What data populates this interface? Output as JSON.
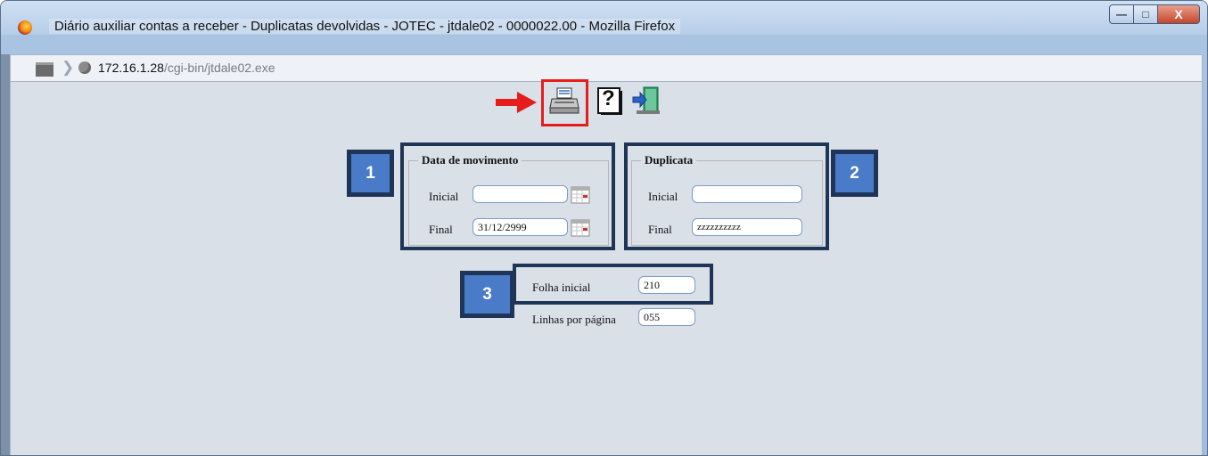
{
  "window": {
    "title": "Diário auxiliar contas a receber - Duplicatas devolvidas - JOTEC - jtdale02 - 0000022.00 - Mozilla Firefox",
    "minimize_label": "—",
    "maximize_label": "□",
    "close_label": "X"
  },
  "address_bar": {
    "host": "172.16.1.28",
    "path": "/cgi-bin/jtdale02.exe"
  },
  "toolbar": {
    "icons": [
      "printer-icon",
      "help-icon",
      "exit-icon"
    ],
    "help_glyph": "?"
  },
  "annotations": {
    "badge_1": "1",
    "badge_2": "2",
    "badge_3": "3",
    "highlight_color": "#e61d1d",
    "frame_color": "#1f3557",
    "badge_color": "#4a7bc8"
  },
  "data_movimento": {
    "legend": "Data de movimento",
    "inicial_label": "Inicial",
    "inicial_value": "",
    "final_label": "Final",
    "final_value": "31/12/2999"
  },
  "duplicata": {
    "legend": "Duplicata",
    "inicial_label": "Inicial",
    "inicial_value": "",
    "final_label": "Final",
    "final_value": "zzzzzzzzzz"
  },
  "pagination": {
    "folha_label": "Folha inicial",
    "folha_value": "210",
    "linhas_label": "Linhas por página",
    "linhas_value": "055"
  }
}
